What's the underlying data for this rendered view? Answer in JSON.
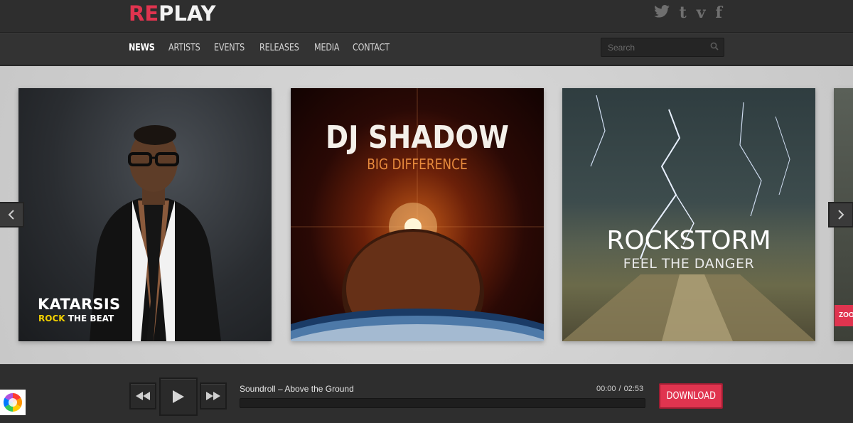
{
  "header": {
    "logo_accent": "RE",
    "logo_rest": "PLAY",
    "social": [
      "twitter-icon",
      "tumblr-icon",
      "vimeo-icon",
      "facebook-icon"
    ],
    "social_glyphs": {
      "tumblr": "t",
      "vimeo": "v",
      "facebook": "f"
    }
  },
  "nav": {
    "items": [
      "NEWS",
      "ARTISTS",
      "EVENTS",
      "RELEASES",
      "MEDIA",
      "CONTACT"
    ],
    "active": "NEWS"
  },
  "search": {
    "placeholder": "Search"
  },
  "slider": {
    "cards": [
      {
        "title": "KATARSIS",
        "sub_highlight": "ROCK",
        "sub_rest": " THE BEAT"
      },
      {
        "title": "DJ SHADOW",
        "subtitle": "BIG DIFFERENCE"
      },
      {
        "title": "ROCKSTORM",
        "subtitle": "FEEL THE DANGER"
      },
      {
        "badge": "ZOO"
      }
    ]
  },
  "player": {
    "track": "Soundroll – Above the Ground",
    "current_time": "00:00",
    "separator": "/",
    "duration": "02:53",
    "progress": 0,
    "download_label": "DOWNLOAD"
  },
  "colors": {
    "accent": "#e0344f",
    "highlight": "#f2d000"
  }
}
